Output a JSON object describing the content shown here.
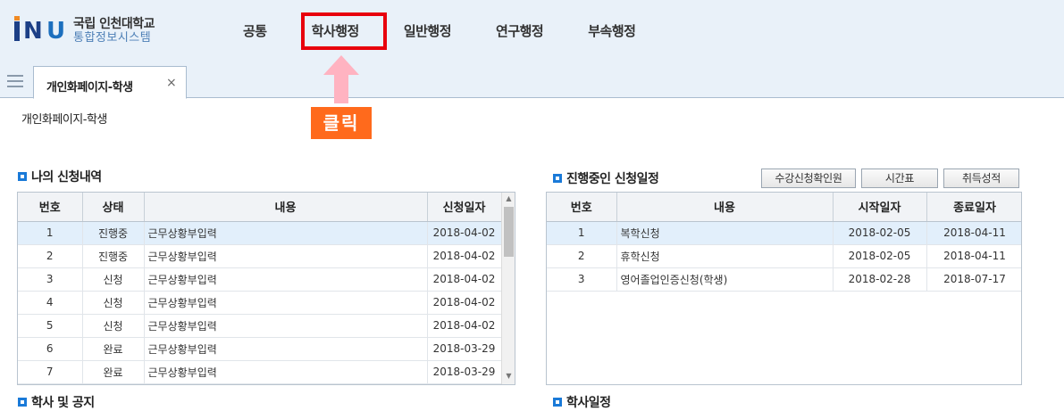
{
  "header": {
    "logo": {
      "mark": "INU",
      "line1": "국립 인천대학교",
      "line2": "통합정보시스템"
    },
    "nav": [
      {
        "label": "공통"
      },
      {
        "label": "학사행정"
      },
      {
        "label": "일반행정"
      },
      {
        "label": "연구행정"
      },
      {
        "label": "부속행정"
      }
    ],
    "highlight_color": "#e8000c"
  },
  "tabs": {
    "open_tab": {
      "label": "개인화페이지-학생",
      "close": "×"
    }
  },
  "annotation": {
    "click_label": "클릭",
    "badge_color": "#ff6a1c",
    "arrow_color": "#ffb3c1"
  },
  "page": {
    "title": "개인화페이지-학생"
  },
  "my_applications": {
    "title": "나의 신청내역",
    "columns": [
      "번호",
      "상태",
      "내용",
      "신청일자"
    ],
    "rows": [
      {
        "no": "1",
        "status": "진행중",
        "content": "근무상황부입력",
        "date": "2018-04-02"
      },
      {
        "no": "2",
        "status": "진행중",
        "content": "근무상황부입력",
        "date": "2018-04-02"
      },
      {
        "no": "3",
        "status": "신청",
        "content": "근무상황부입력",
        "date": "2018-04-02"
      },
      {
        "no": "4",
        "status": "신청",
        "content": "근무상황부입력",
        "date": "2018-04-02"
      },
      {
        "no": "5",
        "status": "신청",
        "content": "근무상황부입력",
        "date": "2018-04-02"
      },
      {
        "no": "6",
        "status": "완료",
        "content": "근무상황부입력",
        "date": "2018-03-29"
      },
      {
        "no": "7",
        "status": "완료",
        "content": "근무상황부입력",
        "date": "2018-03-29"
      }
    ]
  },
  "ongoing_schedule": {
    "title": "진행중인 신청일정",
    "buttons": [
      "수강신청확인원",
      "시간표",
      "취득성적"
    ],
    "columns": [
      "번호",
      "내용",
      "시작일자",
      "종료일자"
    ],
    "rows": [
      {
        "no": "1",
        "content": "복학신청",
        "start": "2018-02-05",
        "end": "2018-04-11"
      },
      {
        "no": "2",
        "content": "휴학신청",
        "start": "2018-02-05",
        "end": "2018-04-11"
      },
      {
        "no": "3",
        "content": "영어졸업인증신청(학생)",
        "start": "2018-02-28",
        "end": "2018-07-17"
      }
    ]
  },
  "bottom_sections": {
    "left": "학사 및 공지",
    "right": "학사일정"
  },
  "icons": {
    "section": "blue-square-icon",
    "menu": "hamburger-icon",
    "close": "close-icon",
    "arrow": "arrow-up-icon"
  }
}
